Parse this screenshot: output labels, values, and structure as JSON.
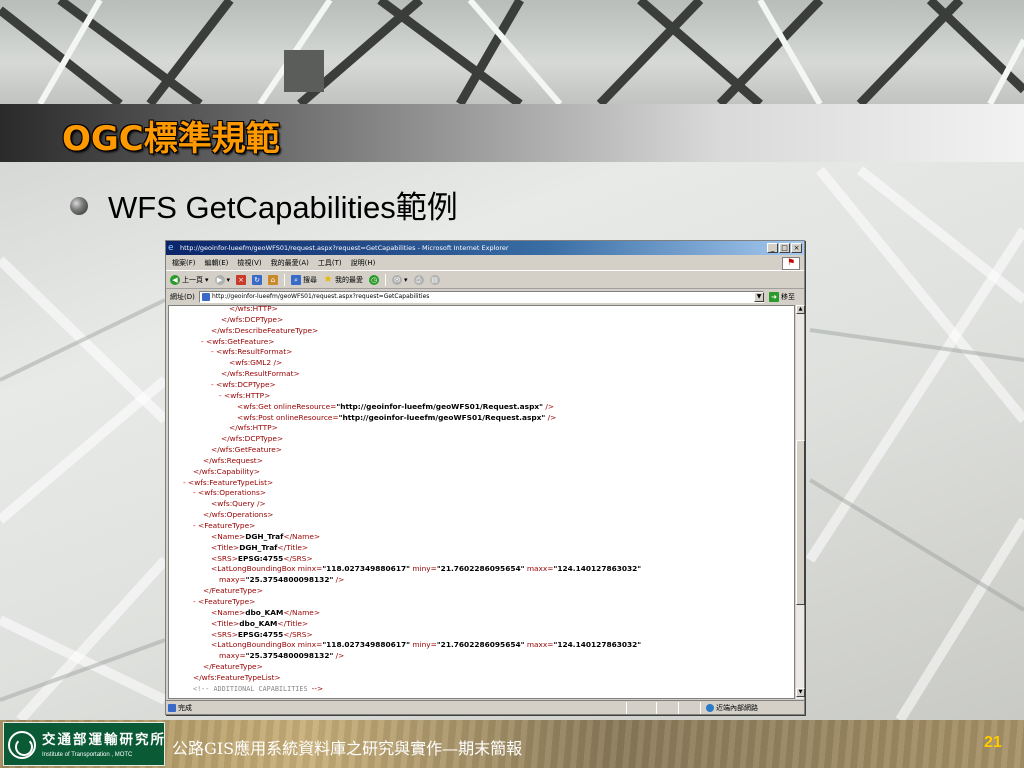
{
  "slide": {
    "title": "OGC標準規範",
    "bullet": "WFS GetCapabilities範例",
    "footer_text": "公路GIS應用系統資料庫之研究與實作—期末簡報",
    "page_number": "21",
    "logo": {
      "name_cn": "交通部運輸研究所",
      "name_en": "Institute of Transportation , MOTC"
    },
    "colors": {
      "title": "#ff9900",
      "page_number": "#ffcc00",
      "logo_bg": "#0a5a36"
    }
  },
  "browser": {
    "window_title": "http://geoinfor-lueefm/geoWFS01/request.aspx?request=GetCapabilities - Microsoft Internet Explorer",
    "window_buttons": [
      "_",
      "□",
      "×"
    ],
    "menu": [
      "檔案(F)",
      "編輯(E)",
      "檢視(V)",
      "我的最愛(A)",
      "工具(T)",
      "說明(H)"
    ],
    "toolbar": {
      "back": "上一頁",
      "search": "搜尋",
      "favorites": "我的最愛"
    },
    "address": {
      "label": "網址(D)",
      "url": "http://geoinfor-lueefm/geoWFS01/request.aspx?request=GetCapabilities",
      "go": "移至"
    },
    "status": {
      "text": "完成",
      "zone": "近端內部網路"
    },
    "icons": [
      "ie-page-icon",
      "back-arrow-icon",
      "forward-arrow-icon",
      "stop-icon",
      "refresh-icon",
      "home-icon",
      "search-icon",
      "favorites-star-icon",
      "history-icon",
      "mail-icon",
      "print-icon",
      "go-arrow-icon",
      "windows-logo-icon"
    ]
  },
  "xml": {
    "lines": [
      {
        "indent": 60,
        "parts": [
          [
            "t",
            "</wfs:HTTP>"
          ]
        ]
      },
      {
        "indent": 52,
        "parts": [
          [
            "t",
            "</wfs:DCPType>"
          ]
        ]
      },
      {
        "indent": 42,
        "parts": [
          [
            "t",
            "</wfs:DescribeFeatureType>"
          ]
        ]
      },
      {
        "indent": 32,
        "parts": [
          [
            "m",
            "- "
          ],
          [
            "t",
            "<wfs:GetFeature>"
          ]
        ]
      },
      {
        "indent": 42,
        "parts": [
          [
            "m",
            "- "
          ],
          [
            "t",
            "<wfs:ResultFormat>"
          ]
        ]
      },
      {
        "indent": 60,
        "parts": [
          [
            "t",
            "<wfs:GML2 />"
          ]
        ]
      },
      {
        "indent": 52,
        "parts": [
          [
            "t",
            "</wfs:ResultFormat>"
          ]
        ]
      },
      {
        "indent": 42,
        "parts": [
          [
            "m",
            "- "
          ],
          [
            "t",
            "<wfs:DCPType>"
          ]
        ]
      },
      {
        "indent": 50,
        "parts": [
          [
            "m",
            "- "
          ],
          [
            "t",
            "<wfs:HTTP>"
          ]
        ]
      },
      {
        "indent": 68,
        "parts": [
          [
            "t",
            "<wfs:Get "
          ],
          [
            "t",
            "onlineResource="
          ],
          [
            "v",
            "\"http://geoinfor-lueefm/geoWFS01/Request.aspx\""
          ],
          [
            "t",
            " />"
          ]
        ]
      },
      {
        "indent": 68,
        "parts": [
          [
            "t",
            "<wfs:Post "
          ],
          [
            "t",
            "onlineResource="
          ],
          [
            "v",
            "\"http://geoinfor-lueefm/geoWFS01/Request.aspx\""
          ],
          [
            "t",
            " />"
          ]
        ]
      },
      {
        "indent": 60,
        "parts": [
          [
            "t",
            "</wfs:HTTP>"
          ]
        ]
      },
      {
        "indent": 52,
        "parts": [
          [
            "t",
            "</wfs:DCPType>"
          ]
        ]
      },
      {
        "indent": 42,
        "parts": [
          [
            "t",
            "</wfs:GetFeature>"
          ]
        ]
      },
      {
        "indent": 34,
        "parts": [
          [
            "t",
            "</wfs:Request>"
          ]
        ]
      },
      {
        "indent": 24,
        "parts": [
          [
            "t",
            "</wfs:Capability>"
          ]
        ]
      },
      {
        "indent": 14,
        "parts": [
          [
            "m",
            "- "
          ],
          [
            "t",
            "<wfs:FeatureTypeList>"
          ]
        ]
      },
      {
        "indent": 24,
        "parts": [
          [
            "m",
            "- "
          ],
          [
            "t",
            "<wfs:Operations>"
          ]
        ]
      },
      {
        "indent": 42,
        "parts": [
          [
            "t",
            "<wfs:Query />"
          ]
        ]
      },
      {
        "indent": 34,
        "parts": [
          [
            "t",
            "</wfs:Operations>"
          ]
        ]
      },
      {
        "indent": 24,
        "parts": [
          [
            "m",
            "- "
          ],
          [
            "t",
            "<FeatureType>"
          ]
        ]
      },
      {
        "indent": 42,
        "parts": [
          [
            "t",
            "<Name>"
          ],
          [
            "v",
            "DGH_Traf"
          ],
          [
            "t",
            "</Name>"
          ]
        ]
      },
      {
        "indent": 42,
        "parts": [
          [
            "t",
            "<Title>"
          ],
          [
            "v",
            "DGH_Traf"
          ],
          [
            "t",
            "</Title>"
          ]
        ]
      },
      {
        "indent": 42,
        "parts": [
          [
            "t",
            "<SRS>"
          ],
          [
            "v",
            "EPSG:4755"
          ],
          [
            "t",
            "</SRS>"
          ]
        ]
      },
      {
        "indent": 42,
        "parts": [
          [
            "t",
            "<LatLongBoundingBox "
          ],
          [
            "t",
            "minx="
          ],
          [
            "v",
            "\"118.027349880617\""
          ],
          [
            "t",
            " miny="
          ],
          [
            "v",
            "\"21.7602286095654\""
          ],
          [
            "t",
            " maxx="
          ],
          [
            "v",
            "\"124.140127863032\""
          ]
        ]
      },
      {
        "indent": 50,
        "parts": [
          [
            "t",
            "maxy="
          ],
          [
            "v",
            "\"25.3754800098132\""
          ],
          [
            "t",
            " />"
          ]
        ]
      },
      {
        "indent": 34,
        "parts": [
          [
            "t",
            "</FeatureType>"
          ]
        ]
      },
      {
        "indent": 24,
        "parts": [
          [
            "m",
            "- "
          ],
          [
            "t",
            "<FeatureType>"
          ]
        ]
      },
      {
        "indent": 42,
        "parts": [
          [
            "t",
            "<Name>"
          ],
          [
            "v",
            "dbo_KAM"
          ],
          [
            "t",
            "</Name>"
          ]
        ]
      },
      {
        "indent": 42,
        "parts": [
          [
            "t",
            "<Title>"
          ],
          [
            "v",
            "dbo_KAM"
          ],
          [
            "t",
            "</Title>"
          ]
        ]
      },
      {
        "indent": 42,
        "parts": [
          [
            "t",
            "<SRS>"
          ],
          [
            "v",
            "EPSG:4755"
          ],
          [
            "t",
            "</SRS>"
          ]
        ]
      },
      {
        "indent": 42,
        "parts": [
          [
            "t",
            "<LatLongBoundingBox "
          ],
          [
            "t",
            "minx="
          ],
          [
            "v",
            "\"118.027349880617\""
          ],
          [
            "t",
            " miny="
          ],
          [
            "v",
            "\"21.7602286095654\""
          ],
          [
            "t",
            " maxx="
          ],
          [
            "v",
            "\"124.140127863032\""
          ]
        ]
      },
      {
        "indent": 50,
        "parts": [
          [
            "t",
            "maxy="
          ],
          [
            "v",
            "\"25.3754800098132\""
          ],
          [
            "t",
            " />"
          ]
        ]
      },
      {
        "indent": 34,
        "parts": [
          [
            "t",
            "</FeatureType>"
          ]
        ]
      },
      {
        "indent": 24,
        "parts": [
          [
            "t",
            "</wfs:FeatureTypeList>"
          ]
        ]
      },
      {
        "indent": 24,
        "parts": [
          [
            "c",
            "<!--  ADDITIONAL CAPABILITIES  "
          ],
          [
            "t",
            "-->"
          ]
        ]
      }
    ]
  }
}
